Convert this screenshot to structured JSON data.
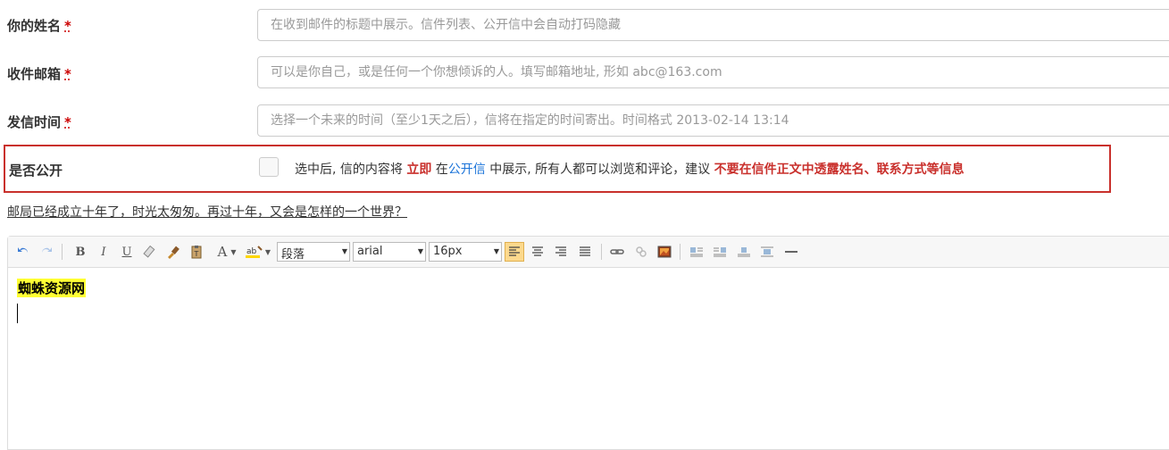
{
  "form": {
    "name": {
      "label": "你的姓名",
      "required_mark": "*",
      "placeholder": "在收到邮件的标题中展示。信件列表、公开信中会自动打码隐藏"
    },
    "email": {
      "label": "收件邮箱",
      "required_mark": "*",
      "placeholder": "可以是你自己，或是任何一个你想倾诉的人。填写邮箱地址, 形如 abc@163.com"
    },
    "send_time": {
      "label": "发信时间",
      "required_mark": "*",
      "placeholder": "选择一个未来的时间（至少1天之后），信将在指定的时间寄出。时间格式 2013-02-14 13:14"
    },
    "public": {
      "label": "是否公开",
      "checked": false,
      "text_part1": "选中后, 信的内容将 ",
      "text_immediate": "立即",
      "text_part2": " 在",
      "text_public_letter": "公开信",
      "text_part3": " 中展示, 所有人都可以浏览和评论，建议 ",
      "text_warning": "不要在信件正文中透露姓名、联系方式等信息"
    }
  },
  "quote_link": "邮局已经成立十年了，时光太匆匆。再过十年，又会是怎样的一个世界？",
  "editor": {
    "toolbar": {
      "paragraph": "段落",
      "font": "arial",
      "size": "16px"
    },
    "content_text": "蜘蛛资源网"
  },
  "colors": {
    "accent_red": "#c9302c",
    "link_blue": "#1a73d9",
    "highlight": "#ffff33"
  }
}
